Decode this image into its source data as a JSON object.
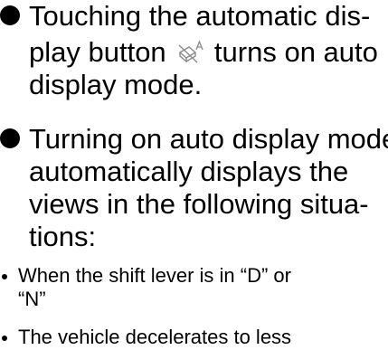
{
  "bullets": [
    {
      "line1": "Touching the automatic dis-",
      "line2_before": "play button",
      "line2_after": "turns on auto",
      "line3": "display mode.",
      "icon": "auto-display-off-icon"
    },
    {
      "line1": "Turning on auto display mode",
      "line2": "automatically displays the",
      "line3": "views in the following situa-",
      "line4": "tions:"
    }
  ],
  "sub_items": [
    {
      "line1": "When the shift lever is in “D” or",
      "line2": "“N”"
    },
    {
      "line1": "The vehicle decelerates to less"
    }
  ]
}
